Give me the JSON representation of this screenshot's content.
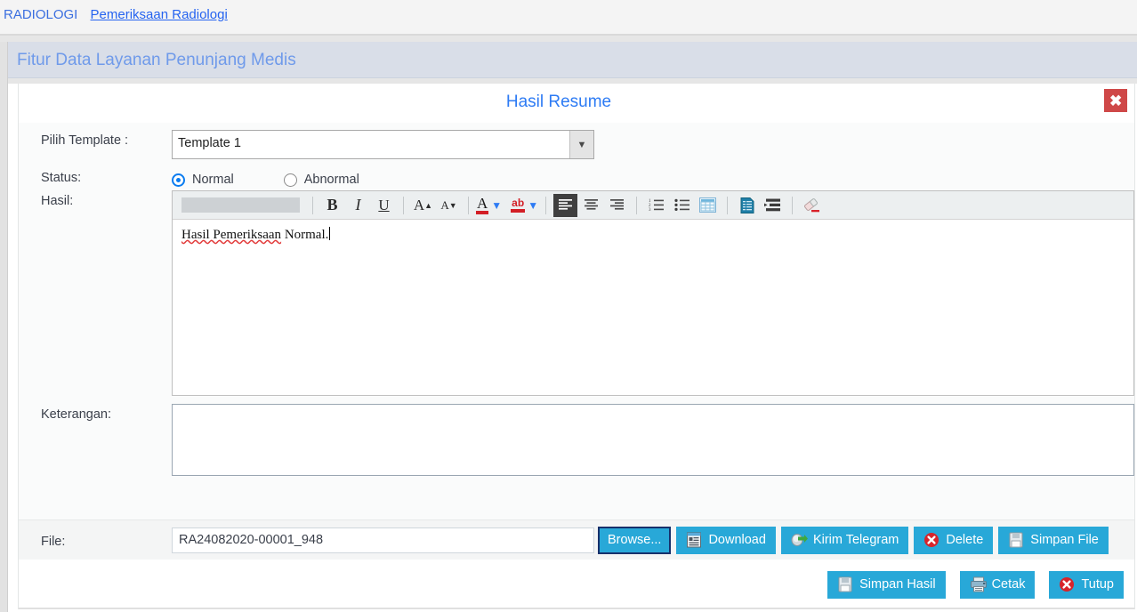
{
  "breadcrumb": {
    "root": "RADIOLOGI",
    "current": "Pemeriksaan Radiologi"
  },
  "feature_header": {
    "title": "Fitur Data Layanan Penunjang Medis"
  },
  "card": {
    "title": "Hasil Resume",
    "close_icon": "close-x-icon"
  },
  "form": {
    "template": {
      "label": "Pilih Template :",
      "value": "Template 1",
      "arrow_icon": "chevron-down-icon"
    },
    "status": {
      "label": "Status:",
      "options": [
        {
          "label": "Normal",
          "selected": true
        },
        {
          "label": "Abnormal",
          "selected": false
        }
      ]
    },
    "hasil": {
      "label": "Hasil:",
      "content": "Hasil Pemeriksaan",
      "content_tail": " Normal."
    },
    "keterangan": {
      "label": "Keterangan:",
      "value": ""
    },
    "file": {
      "label": "File:",
      "value": "RA24082020-00001_948"
    }
  },
  "toolbar": {
    "font_name": "",
    "buttons": [
      {
        "name": "bold-icon",
        "label": "B"
      },
      {
        "name": "italic-icon",
        "label": "I"
      },
      {
        "name": "underline-icon",
        "label": "U"
      },
      {
        "name": "grow-font-icon",
        "label": "A"
      },
      {
        "name": "shrink-font-icon",
        "label": "A"
      },
      {
        "name": "font-color-icon",
        "label": "A"
      },
      {
        "name": "highlight-color-icon",
        "label": "ab"
      },
      {
        "name": "align-left-icon",
        "label": ""
      },
      {
        "name": "align-center-icon",
        "label": ""
      },
      {
        "name": "align-right-icon",
        "label": ""
      },
      {
        "name": "numbered-list-icon",
        "label": ""
      },
      {
        "name": "bullet-list-icon",
        "label": ""
      },
      {
        "name": "insert-table-icon",
        "label": ""
      },
      {
        "name": "document-icon",
        "label": ""
      },
      {
        "name": "indent-icon",
        "label": ""
      },
      {
        "name": "clear-format-icon",
        "label": ""
      }
    ]
  },
  "file_buttons": [
    {
      "name": "browse-button",
      "label": "Browse...",
      "icon": ""
    },
    {
      "name": "download-button",
      "label": "Download",
      "icon": "document-icon"
    },
    {
      "name": "kirim-telegram-button",
      "label": "Kirim Telegram",
      "icon": "telegram-icon"
    },
    {
      "name": "delete-button",
      "label": "Delete",
      "icon": "delete-x-icon"
    },
    {
      "name": "simpan-file-button",
      "label": "Simpan File",
      "icon": "floppy-icon"
    }
  ],
  "action_buttons": [
    {
      "name": "simpan-hasil-button",
      "label": "Simpan Hasil",
      "icon": "floppy-icon"
    },
    {
      "name": "cetak-button",
      "label": "Cetak",
      "icon": "printer-icon"
    },
    {
      "name": "tutup-button",
      "label": "Tutup",
      "icon": "delete-x-icon"
    }
  ],
  "colors": {
    "accent_blue": "#2d7bf4",
    "button_cyan": "#28a8d8",
    "header_band": "#d9dee8",
    "close_red": "#cf4848",
    "delete_red": "#d8232a"
  }
}
